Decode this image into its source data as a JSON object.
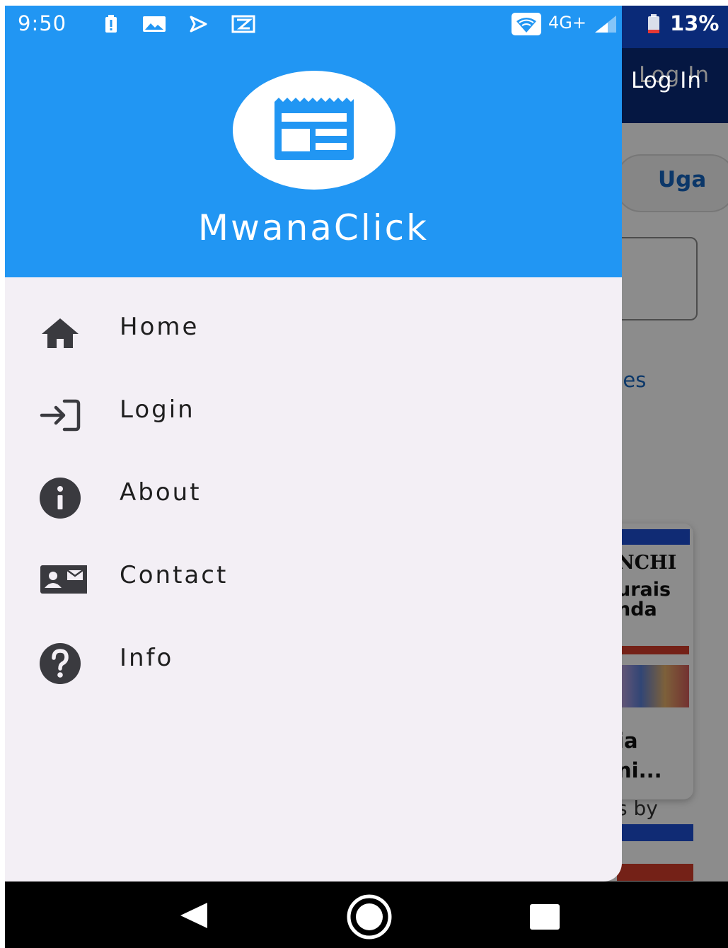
{
  "status_bar": {
    "time": "9:50",
    "network": "4G+",
    "battery": "13%"
  },
  "drawer": {
    "app_name": "MwanaClick",
    "menu": [
      {
        "label": "Home",
        "icon": "home-icon"
      },
      {
        "label": "Login",
        "icon": "login-icon"
      },
      {
        "label": "About",
        "icon": "info-circle-icon"
      },
      {
        "label": "Contact",
        "icon": "contact-card-icon"
      },
      {
        "label": "Info",
        "icon": "help-circle-icon"
      }
    ]
  },
  "background": {
    "appbar_action": "Log In",
    "chip_label": "Uga",
    "section_link": "ges",
    "thumb_title": "NCHI",
    "thumb_sub1": "urais",
    "thumb_sub2": "nda",
    "card_line1": "ia",
    "card_line2": "ni...",
    "byline": "s by"
  },
  "colors": {
    "drawer_header": "#2196f3",
    "drawer_body": "#f3eff5",
    "appbar": "#0a2a78",
    "icon_gray": "#3a3a3f"
  }
}
